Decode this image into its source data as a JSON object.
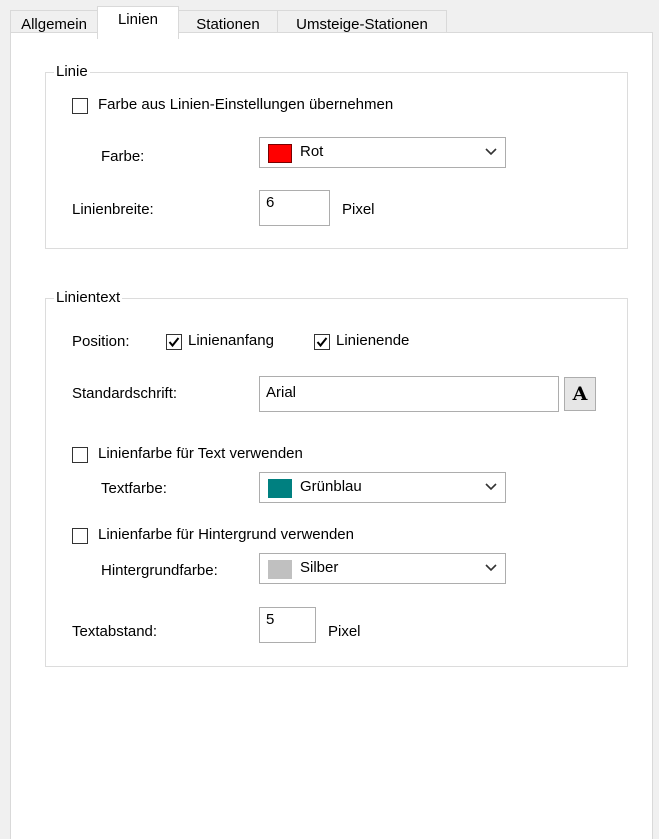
{
  "tabs": [
    {
      "label": "Allgemein",
      "active": false
    },
    {
      "label": "Linien",
      "active": true
    },
    {
      "label": "Stationen",
      "active": false
    },
    {
      "label": "Umsteige-Stationen",
      "active": false
    }
  ],
  "linie": {
    "title": "Linie",
    "use_line_color_label": "Farbe aus Linien-Einstellungen übernehmen",
    "use_line_color_checked": false,
    "color_label": "Farbe:",
    "color_value": "Rot",
    "color_swatch": "#ff0000",
    "width_label": "Linienbreite:",
    "width_value": "6",
    "width_unit": "Pixel"
  },
  "linientext": {
    "title": "Linientext",
    "position_label": "Position:",
    "start_label": "Linienanfang",
    "start_checked": true,
    "end_label": "Linienende",
    "end_checked": true,
    "font_label": "Standardschrift:",
    "font_value": "Arial",
    "font_button_glyph": "A",
    "text_color_use_label": "Linienfarbe für Text verwenden",
    "text_color_use_checked": false,
    "text_color_label": "Textfarbe:",
    "text_color_value": "Grünblau",
    "text_color_swatch": "#008080",
    "bg_color_use_label": "Linienfarbe für Hintergrund verwenden",
    "bg_color_use_checked": false,
    "bg_color_label": "Hintergrundfarbe:",
    "bg_color_value": "Silber",
    "bg_color_swatch": "#c0c0c0",
    "spacing_label": "Textabstand:",
    "spacing_value": "5",
    "spacing_unit": "Pixel"
  }
}
